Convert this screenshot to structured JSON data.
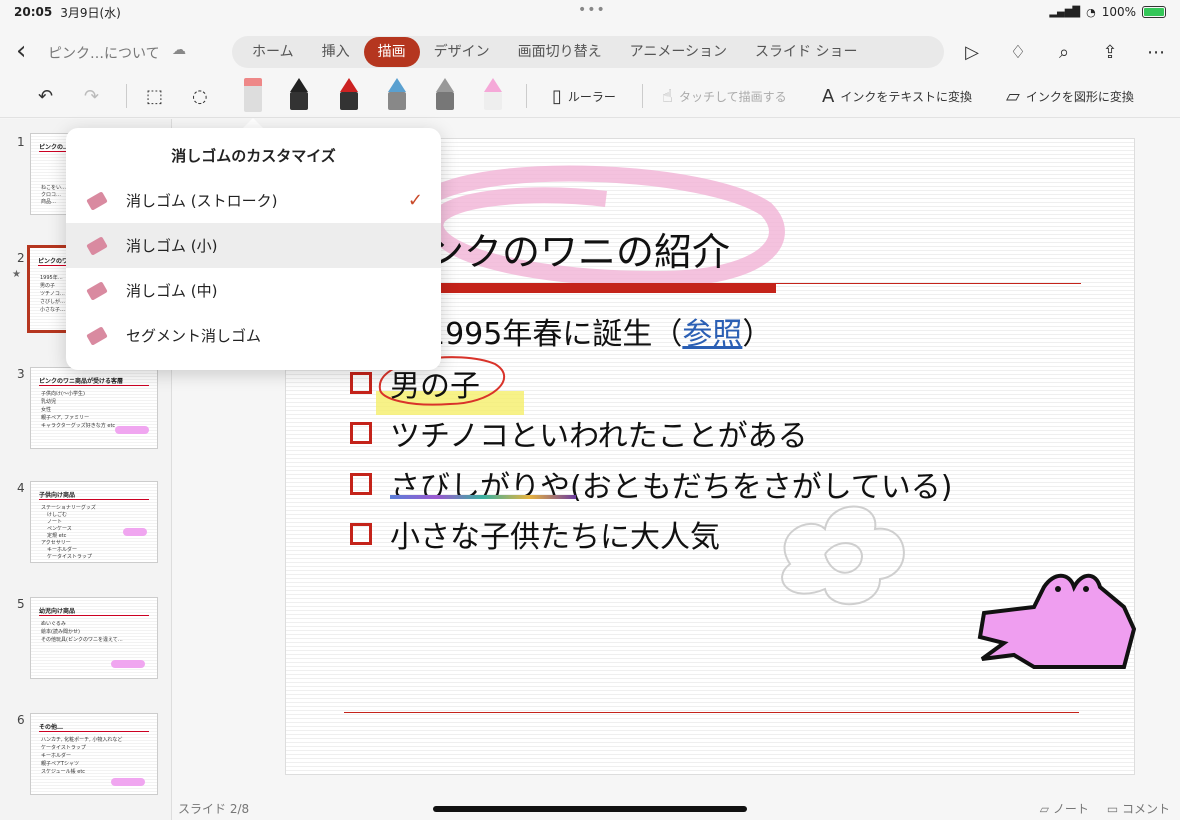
{
  "status": {
    "time": "20:05",
    "date": "3月9日(水)",
    "battery": "100%"
  },
  "header": {
    "doc_title": "ピンク…について",
    "tabs": [
      "ホーム",
      "挿入",
      "描画",
      "デザイン",
      "画面切り替え",
      "アニメーション",
      "スライド ショー"
    ],
    "active_tab": "描画"
  },
  "toolbar": {
    "ruler": "ルーラー",
    "touch_draw": "タッチして描画する",
    "ink_to_text": "インクをテキストに変換",
    "ink_to_shape": "インクを図形に変換",
    "pen_colors": [
      "#333333",
      "#cc2a2a",
      "#5aa0d0",
      "#9a9a9a",
      "#f5a8d8"
    ]
  },
  "popover": {
    "title": "消しゴムのカスタマイズ",
    "items": [
      {
        "label": "消しゴム (ストローク)",
        "checked": true
      },
      {
        "label": "消しゴム (小)",
        "checked": false
      },
      {
        "label": "消しゴム (中)",
        "checked": false
      },
      {
        "label": "セグメント消しゴム",
        "checked": false
      }
    ]
  },
  "thumbnails": [
    {
      "num": "1",
      "title": "ピンクの…",
      "lines": [
        "ねこをい…",
        "クロコ…",
        "商品…"
      ]
    },
    {
      "num": "2",
      "title": "ピンクのワ…",
      "lines": [
        "1995年…",
        "男の子",
        "ツチノコ…",
        "さびしが…",
        "小さな子…"
      ]
    },
    {
      "num": "3",
      "title": "ピンクのワニ商品が受ける客層",
      "lines": [
        "子供向け(〜小学生)",
        "乳幼児",
        "女性",
        "親子ペア, ファミリー",
        "キャラクターグッズ好きな方 etc"
      ]
    },
    {
      "num": "4",
      "title": "子供向け商品",
      "lines": [
        "ステーショナリーグッズ",
        "けしごむ",
        "ノート",
        "ペンケース",
        "定規 etc",
        "アクセサリー",
        "キーホルダー",
        "ケータイストラップ"
      ]
    },
    {
      "num": "5",
      "title": "幼児向け商品",
      "lines": [
        "ぬいぐるみ",
        "絵本(読み聞かせ)",
        "その他玩具(ピンクのワニを違えて…"
      ]
    },
    {
      "num": "6",
      "title": "その他…",
      "lines": [
        "ハンカチ, 化粧ポーチ, 小物入れなど",
        "ケータイストラップ",
        "キーホルダー",
        "親子ペアTシャツ",
        "スケジュール帳 etc"
      ]
    }
  ],
  "slide": {
    "title": "ンクのワニの紹介",
    "bullets": [
      {
        "text": "1995年春に誕生（",
        "link": "参照",
        "after": "）"
      },
      {
        "text": "男の子"
      },
      {
        "text": "ツチノコといわれたことがある"
      },
      {
        "text": "さびしがりや(おともだちをさがしている)"
      },
      {
        "text": "小さな子供たちに大人気"
      }
    ]
  },
  "footer": {
    "slide_counter": "スライド 2/8",
    "notes": "ノート",
    "comments": "コメント"
  }
}
